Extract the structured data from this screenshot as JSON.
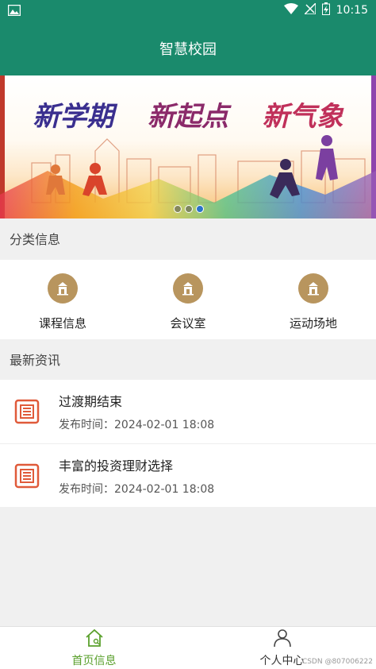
{
  "status_bar": {
    "time": "10:15"
  },
  "app_bar": {
    "title": "智慧校园"
  },
  "banner": {
    "text_parts": [
      "新学期",
      "新起点",
      "新气象"
    ],
    "active_dot": 2,
    "dot_count": 3
  },
  "sections": {
    "category_title": "分类信息",
    "news_title": "最新资讯"
  },
  "categories": [
    {
      "label": "课程信息",
      "icon": "building-icon"
    },
    {
      "label": "会议室",
      "icon": "building-icon"
    },
    {
      "label": "运动场地",
      "icon": "building-icon"
    }
  ],
  "news": [
    {
      "title": "过渡期结束",
      "time": "发布时间：2024-02-01 18:08",
      "icon": "newspaper-icon"
    },
    {
      "title": "丰富的投资理财选择",
      "time": "发布时间：2024-02-01 18:08",
      "icon": "newspaper-icon"
    }
  ],
  "bottom_nav": {
    "home": {
      "label": "首页信息",
      "icon": "home-icon",
      "active": true
    },
    "profile": {
      "label": "个人中心",
      "icon": "person-icon",
      "active": false
    }
  },
  "watermark": "CSDN @807006222",
  "colors": {
    "primary": "#1a8a6c",
    "accent": "#5aa02c",
    "category_icon_bg": "#b8955e",
    "news_icon": "#e05a3a"
  }
}
